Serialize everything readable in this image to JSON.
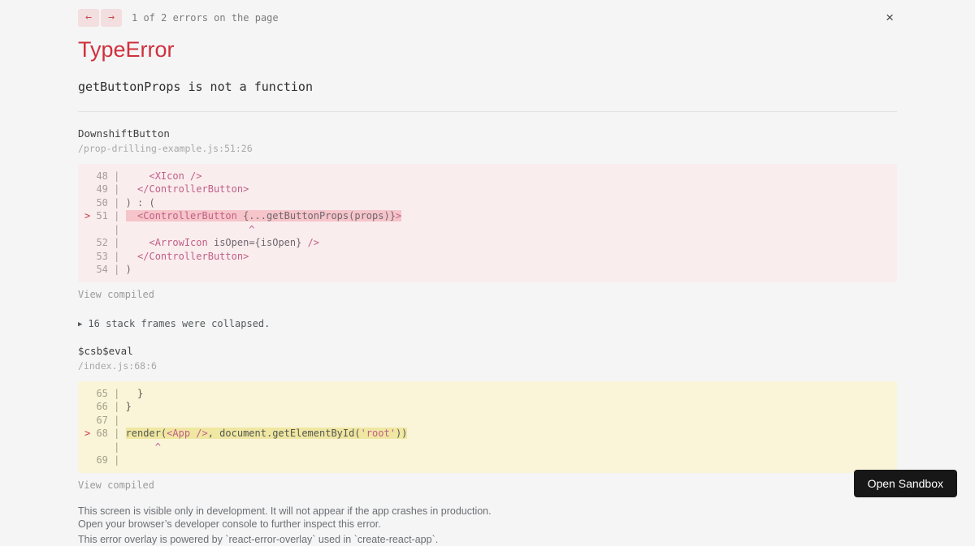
{
  "header": {
    "prev_label": "←",
    "next_label": "→",
    "error_counter": "1 of 2 errors on the page",
    "close_label": "×"
  },
  "error": {
    "title": "TypeError",
    "message": "getButtonProps is not a function"
  },
  "code_blocks": [
    {
      "function_name": "DownshiftButton",
      "file_path": "/prop-drilling-example.js:51:26",
      "view_compiled_label": "View compiled",
      "lines": [
        {
          "num": "48",
          "segs": [
            [
              "plain",
              "    "
            ],
            [
              "tag",
              "<XIcon />"
            ]
          ]
        },
        {
          "num": "49",
          "segs": [
            [
              "plain",
              "  "
            ],
            [
              "tag",
              "</ControllerButton>"
            ]
          ]
        },
        {
          "num": "50",
          "segs": [
            [
              "plain",
              ") : ("
            ]
          ]
        },
        {
          "num": "51",
          "marker": ">",
          "highlight": true,
          "segs": [
            [
              "plain",
              "  "
            ],
            [
              "tag",
              "<ControllerButton "
            ],
            [
              "plain",
              "{...getButtonProps(props)}"
            ],
            [
              "tag",
              ">"
            ]
          ]
        },
        {
          "num": "",
          "segs": [
            [
              "plain",
              "                     "
            ],
            [
              "caret",
              "^"
            ]
          ]
        },
        {
          "num": "52",
          "segs": [
            [
              "plain",
              "    "
            ],
            [
              "tag",
              "<ArrowIcon "
            ],
            [
              "plain",
              "isOpen={isOpen} "
            ],
            [
              "tag",
              "/>"
            ]
          ]
        },
        {
          "num": "53",
          "segs": [
            [
              "plain",
              "  "
            ],
            [
              "tag",
              "</ControllerButton>"
            ]
          ]
        },
        {
          "num": "54",
          "segs": [
            [
              "plain",
              ")"
            ]
          ]
        }
      ]
    },
    {
      "function_name": "$csb$eval",
      "file_path": "/index.js:68:6",
      "view_compiled_label": "View compiled",
      "lines": [
        {
          "num": "65",
          "segs": [
            [
              "plain",
              "  }"
            ]
          ]
        },
        {
          "num": "66",
          "segs": [
            [
              "plain",
              "}"
            ]
          ]
        },
        {
          "num": "67",
          "segs": []
        },
        {
          "num": "68",
          "marker": ">",
          "highlight": true,
          "segs": [
            [
              "plain",
              "render("
            ],
            [
              "tag",
              "<App />"
            ],
            [
              "plain",
              ", document.getElementById("
            ],
            [
              "string",
              "'root'"
            ],
            [
              "plain",
              "))"
            ]
          ]
        },
        {
          "num": "",
          "segs": [
            [
              "plain",
              "     "
            ],
            [
              "caret",
              "^"
            ]
          ]
        },
        {
          "num": "69",
          "segs": []
        }
      ]
    }
  ],
  "collapsed_frames": {
    "icon": "▶",
    "label": "16 stack frames were collapsed."
  },
  "footer": {
    "lines": [
      "This screen is visible only in development. It will not appear if the app crashes in production.",
      "Open your browser’s developer console to further inspect this error.",
      "This error overlay is powered by `react-error-overlay` used in `create-react-app`."
    ],
    "open_sandbox_label": "Open Sandbox"
  },
  "colors": {
    "accent_red": "#d0303e",
    "page_background": "#f5f5f5",
    "error_block_background": "#faedee",
    "error_line_highlight": "#f6c5c9",
    "warning_block_background": "#faf5d8",
    "warning_line_highlight": "#efe7a2",
    "code_pink": "#c05f88",
    "button_background": "#171717"
  }
}
